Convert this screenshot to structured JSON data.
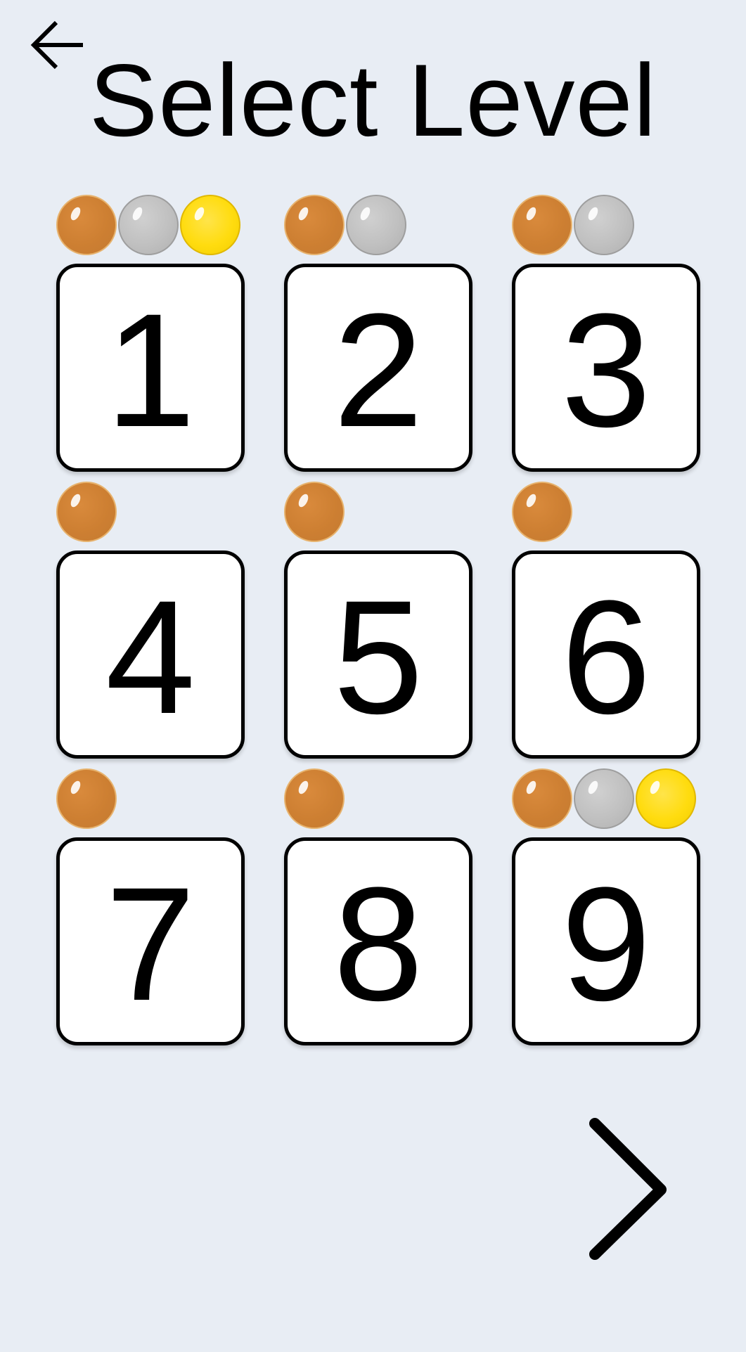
{
  "header": {
    "title": "Select Level",
    "back_icon": "arrow-left-icon"
  },
  "levels": [
    {
      "label": "1",
      "medals": [
        "bronze",
        "silver",
        "gold"
      ]
    },
    {
      "label": "2",
      "medals": [
        "bronze",
        "silver"
      ]
    },
    {
      "label": "3",
      "medals": [
        "bronze",
        "silver"
      ]
    },
    {
      "label": "4",
      "medals": [
        "bronze"
      ]
    },
    {
      "label": "5",
      "medals": [
        "bronze"
      ]
    },
    {
      "label": "6",
      "medals": [
        "bronze"
      ]
    },
    {
      "label": "7",
      "medals": [
        "bronze"
      ]
    },
    {
      "label": "8",
      "medals": [
        "bronze"
      ]
    },
    {
      "label": "9",
      "medals": [
        "bronze",
        "silver",
        "gold"
      ]
    }
  ],
  "navigation": {
    "next_icon": "chevron-right-icon"
  },
  "colors": {
    "background": "#e8edf4",
    "bronze": "#cd7f32",
    "silver": "#c0c0c0",
    "gold": "#ffdc0f"
  }
}
